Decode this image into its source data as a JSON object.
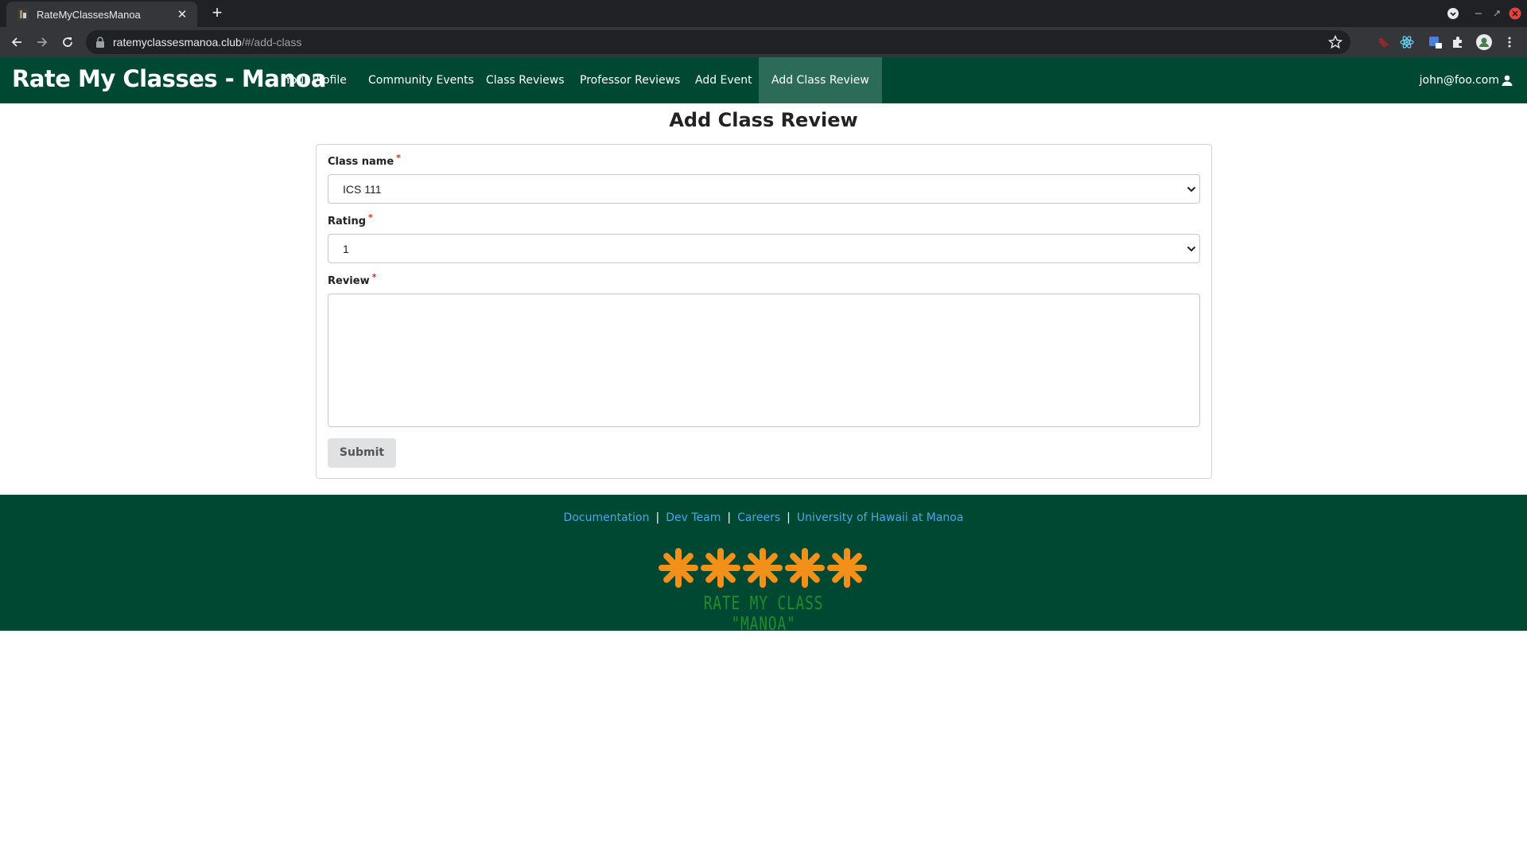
{
  "browser": {
    "tab_title": "RateMyClassesManoa",
    "url_host": "ratemyclassesmanoa.club",
    "url_path": "/#/add-class"
  },
  "navbar": {
    "brand": "Rate My Classes - Manoa",
    "links": [
      "Your Profile",
      "Community Events",
      "Class Reviews",
      "Professor Reviews",
      "Add Event",
      "Add Class Review"
    ],
    "active_link": "Add Class Review",
    "user": "john@foo.com"
  },
  "form": {
    "title": "Add Class Review",
    "class_label": "Class name",
    "class_value": "ICS 111",
    "rating_label": "Rating",
    "rating_value": "1",
    "review_label": "Review",
    "review_value": "",
    "required_mark": "*",
    "submit_label": "Submit"
  },
  "footer": {
    "links": [
      "Documentation",
      "Dev Team",
      "Careers",
      "University of Hawaii at Manoa"
    ],
    "separator": "|",
    "logo_text": "RATE MY CLASS \"MANOA\"",
    "logo_star_count": 5
  },
  "colors": {
    "nav_bg": "#004831",
    "nav_active": "#2b6b57",
    "footer_link": "#4aa8e8",
    "logo_star": "#f39019",
    "logo_text": "#1f8d2f",
    "required": "#db2828"
  }
}
